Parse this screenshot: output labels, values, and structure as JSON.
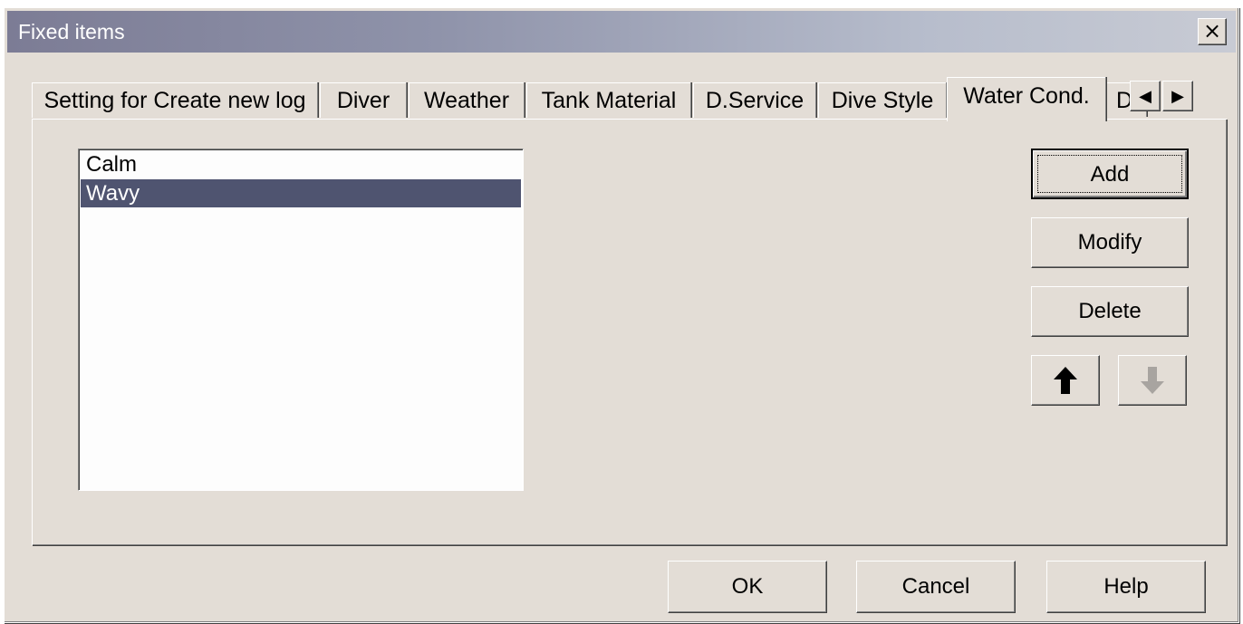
{
  "window": {
    "title": "Fixed items",
    "close_label": "×"
  },
  "tabs": [
    {
      "label": "Setting for Create new log",
      "active": false
    },
    {
      "label": "Diver",
      "active": false
    },
    {
      "label": "Weather",
      "active": false
    },
    {
      "label": "Tank Material",
      "active": false
    },
    {
      "label": "D.Service",
      "active": false
    },
    {
      "label": "Dive Style",
      "active": false
    },
    {
      "label": "Water Cond.",
      "active": true
    },
    {
      "label": "Div",
      "active": false
    }
  ],
  "tab_scroll": {
    "left": "◀",
    "right": "▶"
  },
  "list": {
    "items": [
      "Calm",
      "Wavy"
    ],
    "selected_index": 1
  },
  "actions": {
    "add": "Add",
    "modify": "Modify",
    "delete": "Delete",
    "move_up_icon": "arrow-up-icon",
    "move_down_icon": "arrow-down-icon",
    "move_down_enabled": false
  },
  "footer": {
    "ok": "OK",
    "cancel": "Cancel",
    "help": "Help"
  }
}
